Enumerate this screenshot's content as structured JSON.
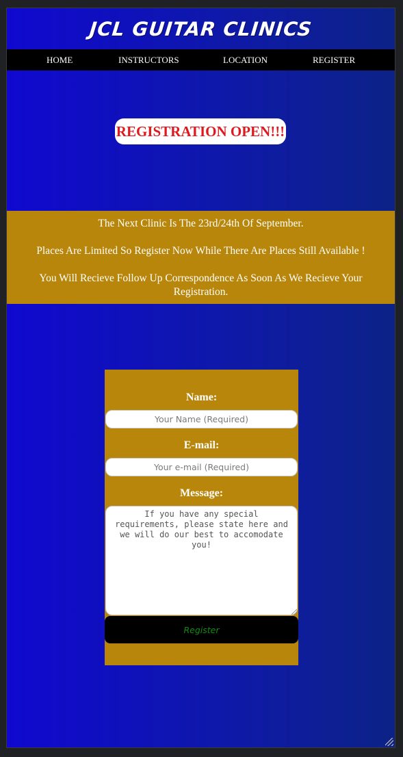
{
  "site": {
    "brand": "JCL GUITAR CLINICS"
  },
  "nav": {
    "items": [
      {
        "label": "HOME"
      },
      {
        "label": "INSTRUCTORS"
      },
      {
        "label": "LOCATION"
      },
      {
        "label": "REGISTER"
      }
    ]
  },
  "announcement": {
    "text": "REGISTRATION OPEN!!!"
  },
  "info": {
    "line1": "The Next Clinic Is The 23rd/24th Of September.",
    "line2": "Places Are Limited So Register Now While There Are Places Still Available !",
    "line3": "You Will Recieve Follow Up Correspondence As Soon As We Recieve Your Registration."
  },
  "form": {
    "name_label": "Name:",
    "name_placeholder": "Your Name (Required)",
    "email_label": "E-mail:",
    "email_placeholder": "Your e-mail (Required)",
    "message_label": "Message:",
    "message_placeholder": "If you have any special requirements, please state here and we will do our best to accomodate you!",
    "submit_label": "Register"
  },
  "colors": {
    "page_gradient_start": "#1008d0",
    "page_gradient_end": "#0d2287",
    "nav_bg": "#000000",
    "gold_panel": "#b8860b",
    "announcement_text": "#e0191e",
    "submit_text": "#138a13"
  }
}
